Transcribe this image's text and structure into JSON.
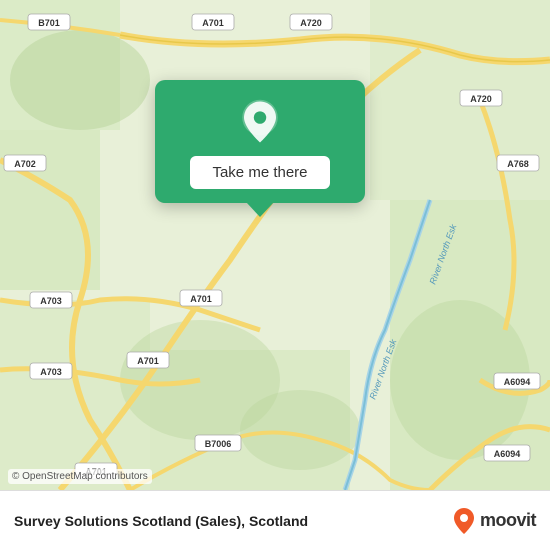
{
  "map": {
    "copyright": "© OpenStreetMap contributors",
    "road_labels": [
      "B701",
      "A701",
      "A720",
      "A702",
      "A720",
      "A768",
      "A703",
      "A701",
      "A703",
      "B7006",
      "A701",
      "A6094",
      "A6094"
    ],
    "river_labels": [
      "River North Esk",
      "River North Esk"
    ],
    "background_color": "#e8f0d8"
  },
  "popup": {
    "button_label": "Take me there",
    "background_color": "#2eaa6e"
  },
  "bottom_bar": {
    "title": "Survey Solutions Scotland (Sales), Scotland",
    "subtitle": "Scotland",
    "copyright": "© OpenStreetMap contributors"
  },
  "branding": {
    "name": "moovit"
  }
}
